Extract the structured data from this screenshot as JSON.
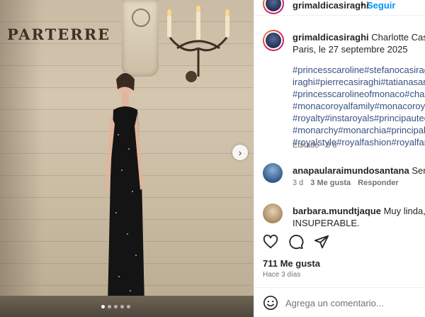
{
  "photo": {
    "sign_text": "PARTERRE",
    "next_icon": "chevron-right-icon",
    "slide_count": 5,
    "active_slide": 0
  },
  "post": {
    "author": "grimaldicasiraghi",
    "follow_label": "Seguir",
    "separator": "•",
    "caption_author": "grimaldicasiraghi",
    "caption_text": "Charlotte Casiragh",
    "caption_place": "Paris, le 27 septembre 2025",
    "hashtag_lines": [
      "#princesscaroline#stefanocasiraghi#a",
      "iraghi#pierrecasiraghi#tatianasantod",
      "#princesscarolineofmonaco#chanel #",
      "#monacoroyalfamily#monacoroyals#",
      "#royalty#instaroyals#principautedem",
      "#monarchy#monarchia#principalityc",
      "#royalstyle#royalfashion#royalfamilie"
    ],
    "edited_label": "Editado · 3 d"
  },
  "comments": [
    {
      "user": "anapaularaimundosantana",
      "text": "Sempre l",
      "time": "3 d",
      "likes": "3 Me gusta",
      "reply": "Responder"
    },
    {
      "user": "barbara.mundtjaque",
      "text": "Muy linda,pero",
      "line2": "INSUPERABLE."
    }
  ],
  "actions": {
    "like_icon": "heart-icon",
    "comment_icon": "comment-icon",
    "share_icon": "share-icon"
  },
  "likes_label": "711 Me gusta",
  "posted_ago": "Hace 3 días",
  "add_comment": {
    "placeholder": "Agrega un comentario...",
    "emoji_icon": "emoji-icon"
  },
  "colors": {
    "link": "#0095f6",
    "hashtag": "#385185",
    "muted": "#737373"
  }
}
